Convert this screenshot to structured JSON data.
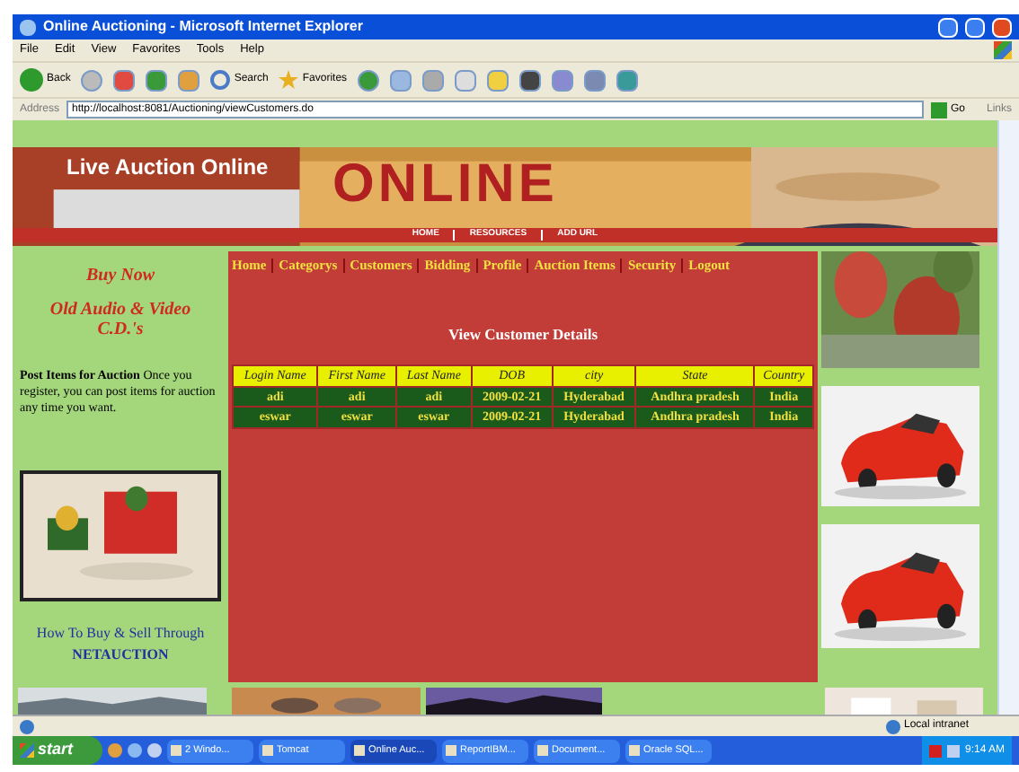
{
  "window": {
    "title": "Online Auctioning - Microsoft Internet Explorer"
  },
  "menu": [
    "File",
    "Edit",
    "View",
    "Favorites",
    "Tools",
    "Help"
  ],
  "toolbar": {
    "back": "Back",
    "search": "Search",
    "favorites": "Favorites"
  },
  "address": {
    "label": "Address",
    "url": "http://localhost:8081/Auctioning/viewCustomers.do",
    "go": "Go",
    "links": "Links"
  },
  "banner": {
    "title": "Live Auction Online",
    "big": "ONLINE",
    "nav": [
      "HOME",
      "RESOURCES",
      "ADD URL"
    ]
  },
  "left": {
    "heading": "Buy Now",
    "subheading": "Old Audio & Video C.D.'s",
    "paragraph": "**Post Items for Auction** Once you register, you can post items for auction any time you want.",
    "howto": "How To Buy & Sell Through",
    "brand": "NETAUCTION"
  },
  "nav": [
    "Home",
    "Categorys",
    "Customers",
    "Bidding",
    "Profile",
    "Auction Items",
    "Security",
    "Logout"
  ],
  "section_title": "View Customer Details",
  "table": {
    "columns": [
      "Login Name",
      "First Name",
      "Last Name",
      "DOB",
      "city",
      "State",
      "Country"
    ],
    "rows": [
      [
        "adi",
        "adi",
        "adi",
        "2009-02-21",
        "Hyderabad",
        "Andhra pradesh",
        "India"
      ],
      [
        "eswar",
        "eswar",
        "eswar",
        "2009-02-21",
        "Hyderabad",
        "Andhra pradesh",
        "India"
      ]
    ]
  },
  "status_bar": {
    "zone": "Local intranet"
  },
  "taskbar": {
    "start": "start",
    "items": [
      {
        "label": "2 Windo...",
        "selected": false
      },
      {
        "label": "Tomcat",
        "selected": false
      },
      {
        "label": "Online Auc...",
        "selected": true
      },
      {
        "label": "ReportIBM...",
        "selected": false
      },
      {
        "label": "Document...",
        "selected": false
      },
      {
        "label": "Oracle SQL...",
        "selected": false
      }
    ],
    "clock": "9:14 AM"
  }
}
